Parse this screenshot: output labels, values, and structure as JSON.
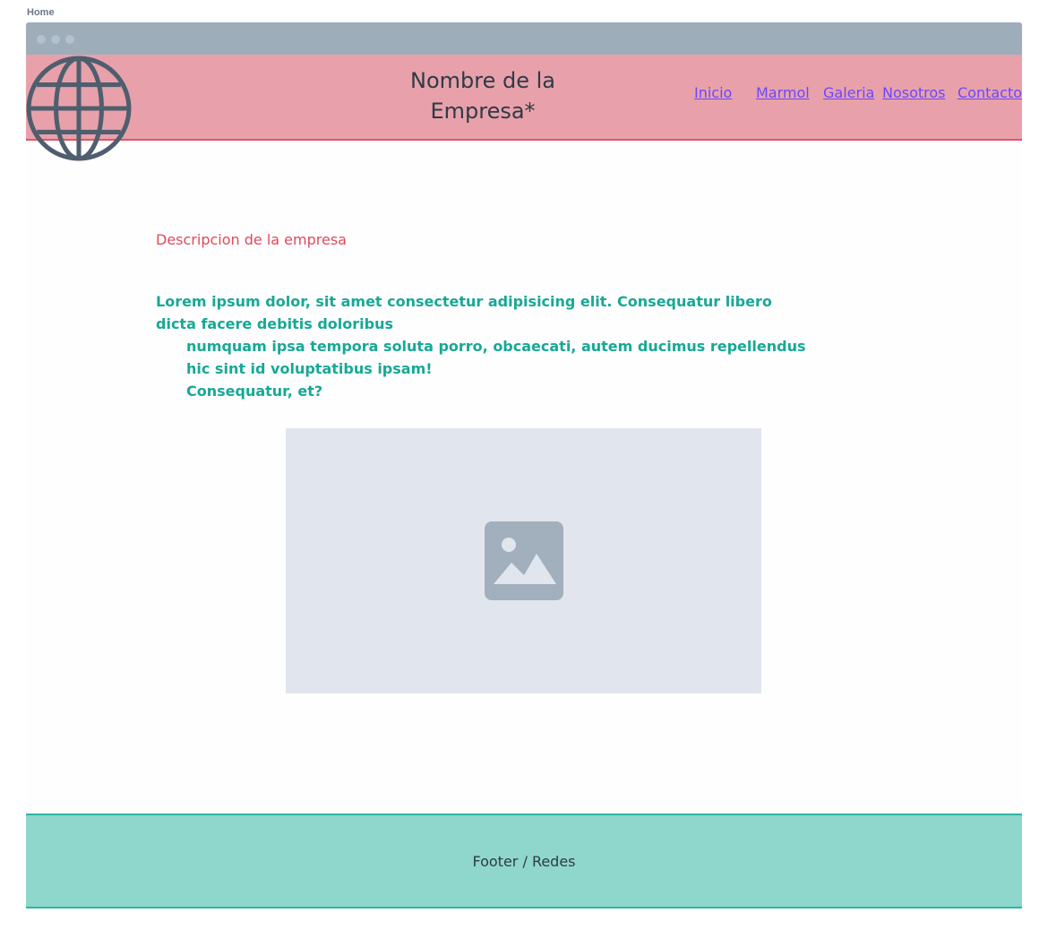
{
  "page": {
    "label": "Home"
  },
  "header": {
    "company_name_line1": "Nombre de la",
    "company_name_line2": "Empresa*",
    "logo_icon": "globe-icon",
    "nav": [
      {
        "label": "Inicio"
      },
      {
        "label": "Marmol"
      },
      {
        "label": "Galeria"
      },
      {
        "label": "Nosotros"
      },
      {
        "label": "Contacto"
      }
    ]
  },
  "main": {
    "description_title": "Descripcion de la empresa",
    "lorem_line1": "Lorem ipsum dolor, sit amet consectetur adipisicing elit. Consequatur libero dicta facere debitis doloribus",
    "lorem_line2": "numquam ipsa tempora soluta porro, obcaecati, autem ducimus repellendus hic sint id voluptatibus ipsam!",
    "lorem_line3": "Consequatur, et?",
    "image_placeholder_icon": "image-placeholder-icon"
  },
  "footer": {
    "text": "Footer / Redes"
  },
  "colors": {
    "titlebar": "#9eadba",
    "header_bg": "#e8a1aa",
    "header_border": "#e05468",
    "nav_link": "#6b47ff",
    "description_title": "#e0495c",
    "body_text": "#17a896",
    "image_bg": "#e1e6ee",
    "footer_bg": "#8fd7cd",
    "footer_border": "#2bb5a4"
  }
}
